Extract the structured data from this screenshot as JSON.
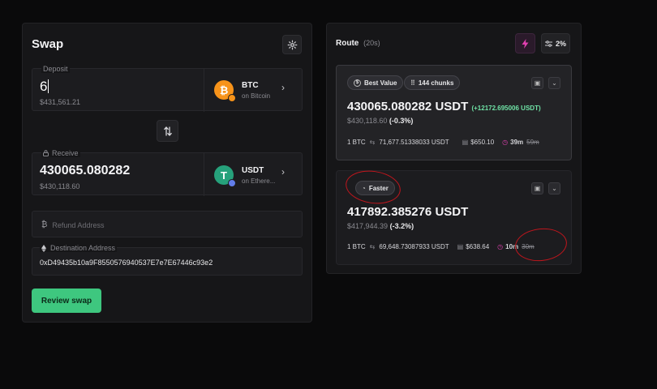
{
  "swap": {
    "title": "Swap",
    "deposit": {
      "label": "Deposit",
      "amount": "6",
      "usd": "$431,561.21",
      "token": "BTC",
      "chain": "on Bitcoin"
    },
    "receive": {
      "label": "Receive",
      "amount": "430065.080282",
      "usd": "$430,118.60",
      "token": "USDT",
      "chain": "on Ethere..."
    },
    "refund": {
      "placeholder": "Refund Address"
    },
    "destination": {
      "label": "Destination Address",
      "value": "0xD49435b10a9F8550576940537E7e7E67446c93e2"
    },
    "review_label": "Review swap"
  },
  "route": {
    "title": "Route",
    "timer": "(20s)",
    "slippage": "2%",
    "quotes": [
      {
        "tags": [
          "Best Value",
          "144 chunks"
        ],
        "amount": "430065.080282 USDT",
        "bonus": "(+12172.695006 USDT)",
        "usd": "$430,118.60",
        "pct": "(-0.3%)",
        "rate_from": "1 BTC",
        "rate_to": "71,677.51338033 USDT",
        "fee": "$650.10",
        "time": "39m",
        "time_old": "59m"
      },
      {
        "tags": [
          "Faster"
        ],
        "amount": "417892.385276 USDT",
        "usd": "$417,944.39",
        "pct": "(-3.2%)",
        "rate_from": "1 BTC",
        "rate_to": "69,648.73087933 USDT",
        "fee": "$638.64",
        "time": "10m",
        "time_old": "30m"
      }
    ]
  },
  "colors": {
    "accent": "#3ec77f",
    "bonus": "#6fe3a6",
    "annotation": "#c0161d",
    "btc": "#f7931a",
    "usdt": "#26a17b"
  },
  "icons": [
    "gear-icon",
    "swap-direction-icon",
    "lock-icon",
    "bitcoin-icon",
    "ethereum-icon",
    "lightning-icon",
    "sliders-icon",
    "chevron-right-icon",
    "chevron-down-icon",
    "chart-icon",
    "dollar-icon",
    "grid-icon",
    "stopwatch-icon",
    "swap-arrows-icon",
    "receipt-icon",
    "clock-icon"
  ]
}
